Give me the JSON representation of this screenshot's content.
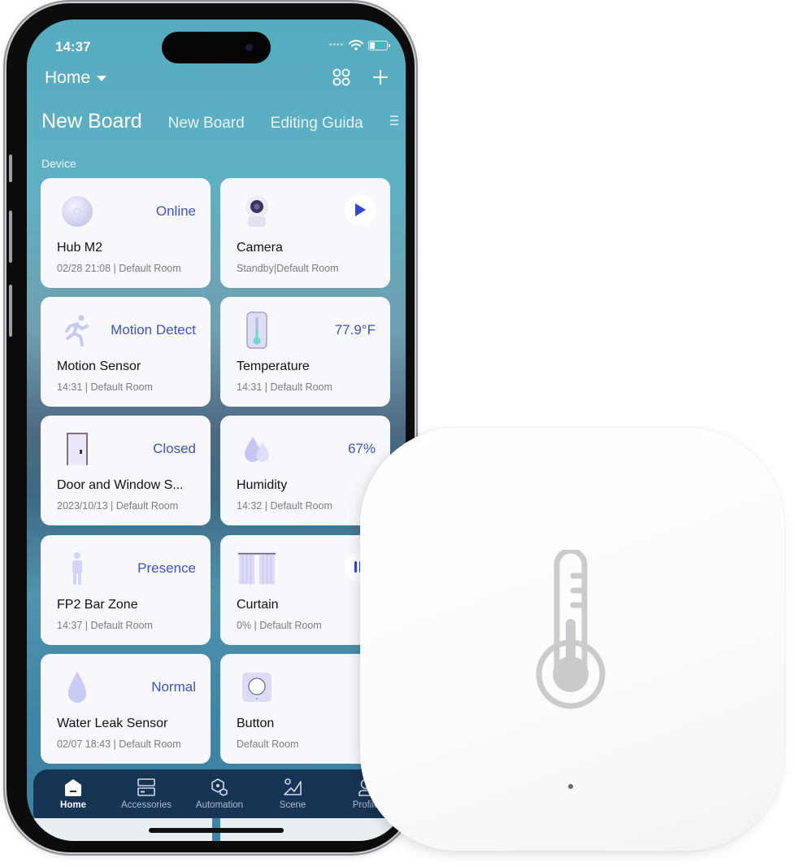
{
  "status_bar": {
    "time": "14:37"
  },
  "header": {
    "home_label": "Home",
    "icons": [
      "grid-icon",
      "plus-icon"
    ]
  },
  "tabs": {
    "active": "New Board",
    "items": [
      "New Board",
      "Editing Guida"
    ],
    "menu_icon": "menu-icon"
  },
  "section_label": "Device",
  "accent_color": "#4052c5",
  "devices": [
    {
      "name": "Hub M2",
      "state": "Online",
      "sub": "02/28 21:08 | Default Room",
      "icon": "hub-icon"
    },
    {
      "name": "Camera",
      "state": "",
      "sub": "Standby|Default Room",
      "icon": "camera-icon",
      "action": "play-icon"
    },
    {
      "name": "Motion Sensor",
      "state": "Motion Detect",
      "sub": "14:31 | Default Room",
      "icon": "running-person-icon"
    },
    {
      "name": "Temperature",
      "state": "77.9°F",
      "sub": "14:31 | Default Room",
      "icon": "thermometer-icon"
    },
    {
      "name": "Door and Window S...",
      "state": "Closed",
      "sub": "2023/10/13 | Default Room",
      "icon": "door-icon"
    },
    {
      "name": "Humidity",
      "state": "67%",
      "sub": "14:32 | Default Room",
      "icon": "water-drops-icon"
    },
    {
      "name": "FP2 Bar Zone",
      "state": "Presence",
      "sub": "14:37 | Default Room",
      "icon": "person-icon"
    },
    {
      "name": "Curtain",
      "state": "",
      "sub": "0% | Default Room",
      "icon": "curtain-icon",
      "action": "curtain-toggle-icon"
    },
    {
      "name": "Water Leak Sensor",
      "state": "Normal",
      "sub": "02/07 18:43 | Default Room",
      "icon": "water-drop-icon"
    },
    {
      "name": "Button",
      "state": "",
      "sub": "Default Room",
      "icon": "button-icon"
    }
  ],
  "bottom_nav": [
    {
      "label": "Home",
      "icon": "home-icon",
      "active": true
    },
    {
      "label": "Accessories",
      "icon": "accessories-icon",
      "active": false
    },
    {
      "label": "Automation",
      "icon": "automation-icon",
      "active": false
    },
    {
      "label": "Scene",
      "icon": "scene-icon",
      "active": false
    },
    {
      "label": "Profile",
      "icon": "profile-icon",
      "active": false
    }
  ],
  "product": {
    "name": "temperature-humidity-sensor",
    "icon": "thermometer-icon"
  }
}
